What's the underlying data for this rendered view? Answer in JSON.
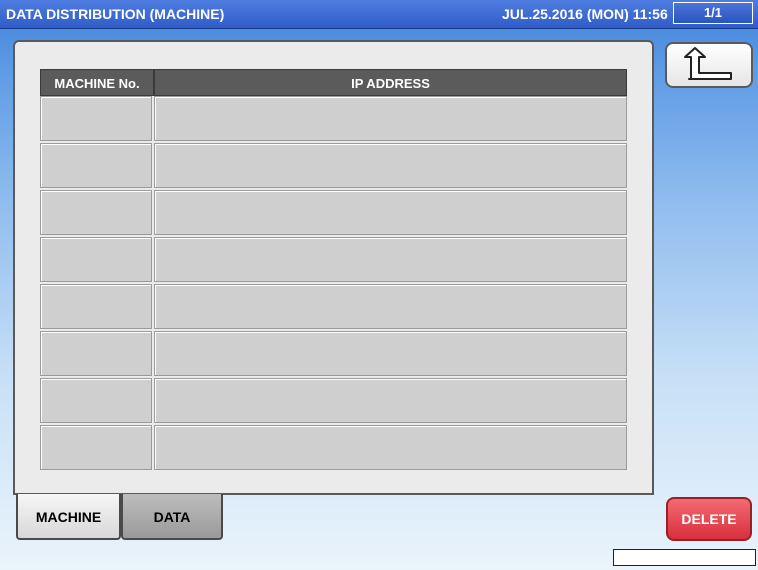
{
  "header": {
    "title": "DATA DISTRIBUTION (MACHINE)",
    "datetime": "JUL.25.2016 (MON)  11:56",
    "page": "1/1"
  },
  "table": {
    "columns": [
      "MACHINE No.",
      "IP ADDRESS"
    ],
    "rows": [
      {
        "machine_no": "",
        "ip_address": ""
      },
      {
        "machine_no": "",
        "ip_address": ""
      },
      {
        "machine_no": "",
        "ip_address": ""
      },
      {
        "machine_no": "",
        "ip_address": ""
      },
      {
        "machine_no": "",
        "ip_address": ""
      },
      {
        "machine_no": "",
        "ip_address": ""
      },
      {
        "machine_no": "",
        "ip_address": ""
      },
      {
        "machine_no": "",
        "ip_address": ""
      }
    ]
  },
  "tabs": [
    {
      "label": "MACHINE",
      "active": true
    },
    {
      "label": "DATA",
      "active": false
    }
  ],
  "buttons": {
    "back_icon": "return-arrow-icon",
    "delete_label": "DELETE"
  },
  "status": {
    "text": ""
  },
  "colors": {
    "titlebar": "#2f5cc8",
    "header_cell": "#5b5b5b",
    "row_cell": "#cfcfcf",
    "delete": "#e0404a"
  }
}
